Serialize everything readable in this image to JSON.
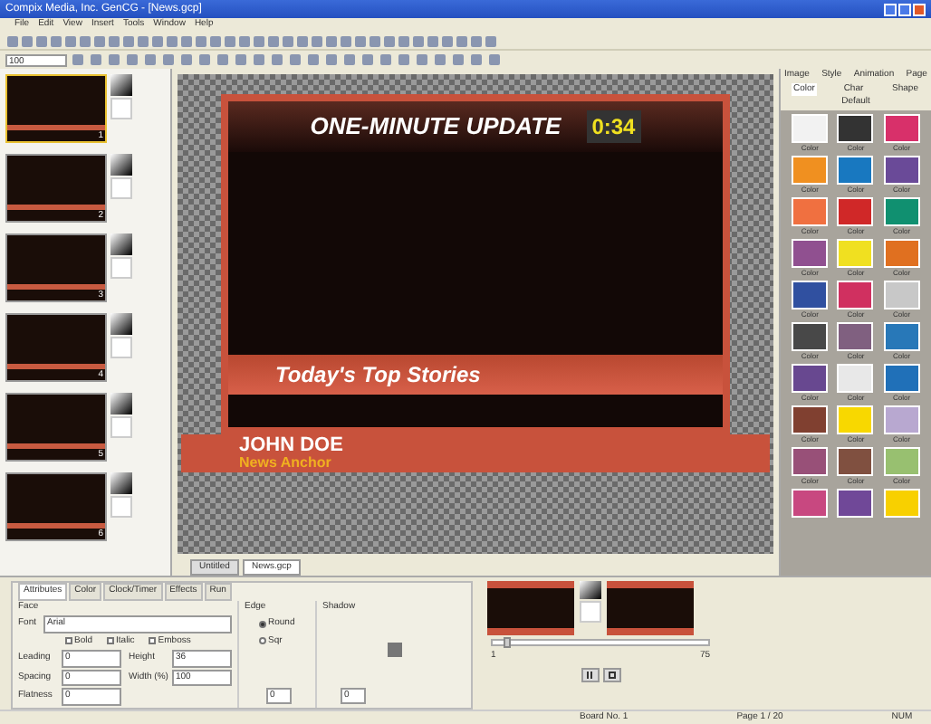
{
  "window": {
    "title": "Compix Media, Inc. GenCG - [News.gcp]"
  },
  "menu": [
    "File",
    "Edit",
    "View",
    "Insert",
    "Tools",
    "Window",
    "Help"
  ],
  "toolbar": {
    "zoom": "100"
  },
  "pages": [
    {
      "number": "1",
      "selected": true
    },
    {
      "number": "2",
      "selected": false
    },
    {
      "number": "3",
      "selected": false
    },
    {
      "number": "4",
      "selected": false
    },
    {
      "number": "5",
      "selected": false
    },
    {
      "number": "6",
      "selected": false
    }
  ],
  "canvas": {
    "headline": "ONE-MINUTE UPDATE",
    "timer": "0:34",
    "banner": "Today's Top Stories",
    "name": "JOHN DOE",
    "role": "News Anchor"
  },
  "doc_tabs": [
    {
      "label": "Untitled",
      "selected": false
    },
    {
      "label": "News.gcp",
      "selected": true
    }
  ],
  "palette": {
    "tabs_row1": [
      "Image",
      "Style",
      "Animation",
      "Page"
    ],
    "tabs_row2": [
      {
        "label": "Color",
        "selected": true
      },
      {
        "label": "Char",
        "selected": false
      },
      {
        "label": "Shape",
        "selected": false
      }
    ],
    "group": "Default",
    "swatches": [
      {
        "color": "#f2f2f2",
        "label": "Color"
      },
      {
        "color": "#333333",
        "label": "Color"
      },
      {
        "color": "#d8306a",
        "label": "Color"
      },
      {
        "color": "#f09020",
        "label": "Color"
      },
      {
        "color": "#1878c0",
        "label": "Color"
      },
      {
        "color": "#6a4a98",
        "label": "Color"
      },
      {
        "color": "#f07040",
        "label": "Color"
      },
      {
        "color": "#d02828",
        "label": "Color"
      },
      {
        "color": "#109070",
        "label": "Color"
      },
      {
        "color": "#905090",
        "label": "Color"
      },
      {
        "color": "#f0e020",
        "label": "Color"
      },
      {
        "color": "#e07020",
        "label": "Color"
      },
      {
        "color": "#3050a0",
        "label": "Color"
      },
      {
        "color": "#d03060",
        "label": "Color"
      },
      {
        "color": "#c8c8c8",
        "label": "Color"
      },
      {
        "color": "#484848",
        "label": "Color"
      },
      {
        "color": "#806080",
        "label": "Color"
      },
      {
        "color": "#2878b8",
        "label": "Color"
      },
      {
        "color": "#684890",
        "label": "Color"
      },
      {
        "color": "#e8e8e8",
        "label": "Color"
      },
      {
        "color": "#2070b8",
        "label": "Color"
      },
      {
        "color": "#804030",
        "label": "Color"
      },
      {
        "color": "#f8d800",
        "label": "Color"
      },
      {
        "color": "#b8a8d0",
        "label": "Color"
      },
      {
        "color": "#985078",
        "label": "Color"
      },
      {
        "color": "#805040",
        "label": "Color"
      },
      {
        "color": "#98c070",
        "label": "Color"
      },
      {
        "color": "#c84880"
      },
      {
        "color": "#704898"
      },
      {
        "color": "#f8d000"
      }
    ]
  },
  "properties": {
    "tabs": [
      {
        "label": "Attributes",
        "selected": true
      },
      {
        "label": "Color",
        "selected": false
      },
      {
        "label": "Clock/Timer",
        "selected": false
      },
      {
        "label": "Effects",
        "selected": false
      },
      {
        "label": "Run",
        "selected": false
      }
    ],
    "face": {
      "title": "Face",
      "font_label": "Font",
      "font": "Arial",
      "options": [
        {
          "label": "Bold",
          "checked": false
        },
        {
          "label": "Italic",
          "checked": false
        },
        {
          "label": "Emboss",
          "checked": false
        }
      ],
      "fields": [
        {
          "label": "Leading",
          "value": "0"
        },
        {
          "label": "Height",
          "value": "36"
        },
        {
          "label": "Spacing",
          "value": "0"
        },
        {
          "label": "Width (%)",
          "value": "100"
        },
        {
          "label": "Flatness",
          "value": "0"
        }
      ]
    },
    "edge": {
      "title": "Edge",
      "options": [
        {
          "label": "Round",
          "selected": true
        },
        {
          "label": "Sqr",
          "selected": false
        }
      ],
      "value": "0"
    },
    "shadow": {
      "title": "Shadow",
      "value": "0"
    }
  },
  "playback": {
    "start": "1",
    "end": "75",
    "level": 0.05
  },
  "status": [
    "Board No. 1",
    "Page 1 / 20",
    "NUM"
  ]
}
